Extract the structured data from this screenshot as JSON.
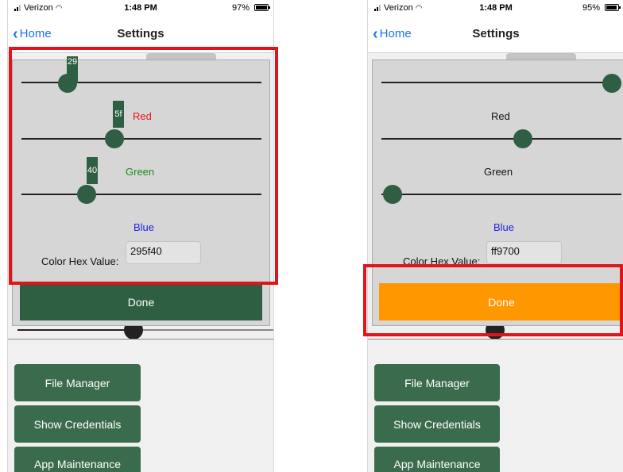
{
  "left": {
    "status": {
      "carrier": "Verizon",
      "time": "1:48 PM",
      "battery": "97%"
    },
    "nav": {
      "back_label": "Home",
      "title": "Settings"
    },
    "sliders": {
      "top_value": "29",
      "red_value": "5f",
      "green_value": "40"
    },
    "labels": {
      "red": "Red",
      "green": "Green",
      "blue": "Blue"
    },
    "hex": {
      "label": "Color Hex Value:",
      "value": "295f40"
    },
    "done_label": "Done",
    "buttons": [
      "File Manager",
      "Show Credentials",
      "App Maintenance"
    ]
  },
  "right": {
    "status": {
      "carrier": "Verizon",
      "time": "1:48 PM",
      "battery": "95%"
    },
    "nav": {
      "back_label": "Home",
      "title": "Settings"
    },
    "labels": {
      "red": "Red",
      "green": "Green",
      "blue": "Blue"
    },
    "hex": {
      "label": "Color Hex Value:",
      "value": "ff9700"
    },
    "done_label": "Done",
    "buttons": [
      "File Manager",
      "Show Credentials",
      "App Maintenance"
    ]
  },
  "colors": {
    "left_accent": "#2f5e44",
    "right_accent": "#ff9700",
    "red_label": "#e8141b",
    "green_label": "#1f8a1f",
    "blue_label": "#1f1fe0",
    "highlight": "#e0141b"
  },
  "icons": [
    "signal-icon",
    "wifi-icon",
    "battery-icon",
    "chevron-left-icon"
  ]
}
